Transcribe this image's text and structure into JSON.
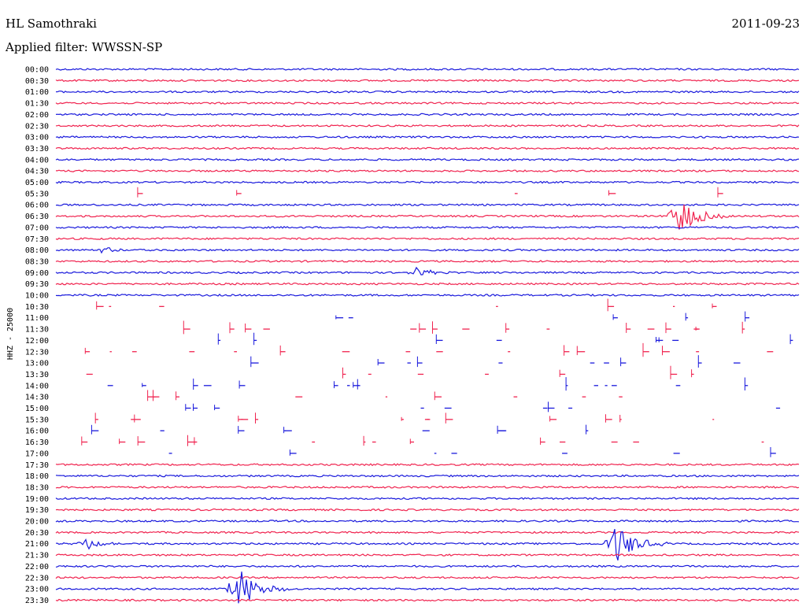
{
  "header": {
    "station": "HL Samothraki",
    "date": "2011-09-23",
    "filter": "Applied filter: WWSSN-SP"
  },
  "colors": {
    "even_row": "#1a1adc",
    "odd_row": "#f0234f"
  },
  "chart_data": {
    "type": "line",
    "title": "",
    "ylabel": "HHZ - 25000",
    "row_labels": [
      "00:00",
      "00:30",
      "01:00",
      "01:30",
      "02:00",
      "02:30",
      "03:00",
      "03:30",
      "04:00",
      "04:30",
      "05:00",
      "05:30",
      "06:00",
      "06:30",
      "07:00",
      "07:30",
      "08:00",
      "08:30",
      "09:00",
      "09:30",
      "10:00",
      "10:30",
      "11:00",
      "11:30",
      "12:00",
      "12:30",
      "13:00",
      "13:30",
      "14:00",
      "14:30",
      "15:00",
      "15:30",
      "16:00",
      "16:30",
      "17:00",
      "17:30",
      "18:00",
      "18:30",
      "19:00",
      "19:30",
      "20:00",
      "20:30",
      "21:00",
      "21:30",
      "22:00",
      "22:30",
      "23:00",
      "23:30"
    ],
    "row_span_minutes": 30,
    "rows_with_continuous_trace": [
      0,
      1,
      2,
      3,
      4,
      5,
      6,
      7,
      8,
      9,
      10,
      12,
      13,
      14,
      15,
      16,
      17,
      18,
      19,
      20,
      35,
      36,
      37,
      38,
      39,
      40,
      41,
      42,
      43,
      44,
      45,
      46,
      47
    ],
    "rows_with_clipped_trace": [
      11,
      21,
      22,
      23,
      24,
      25,
      26,
      27,
      28,
      29,
      30,
      31,
      32,
      33,
      34
    ],
    "events": [
      {
        "row": "06:30",
        "minute": 25,
        "amplitude": "large"
      },
      {
        "row": "08:00",
        "minute": 1.8,
        "amplitude": "small"
      },
      {
        "row": "09:00",
        "minute": 14.5,
        "amplitude": "medium"
      },
      {
        "row": "21:00",
        "minute": 1.2,
        "amplitude": "medium"
      },
      {
        "row": "21:00",
        "minute": 22.5,
        "amplitude": "large"
      },
      {
        "row": "23:00",
        "minute": 7.3,
        "amplitude": "large"
      }
    ]
  }
}
